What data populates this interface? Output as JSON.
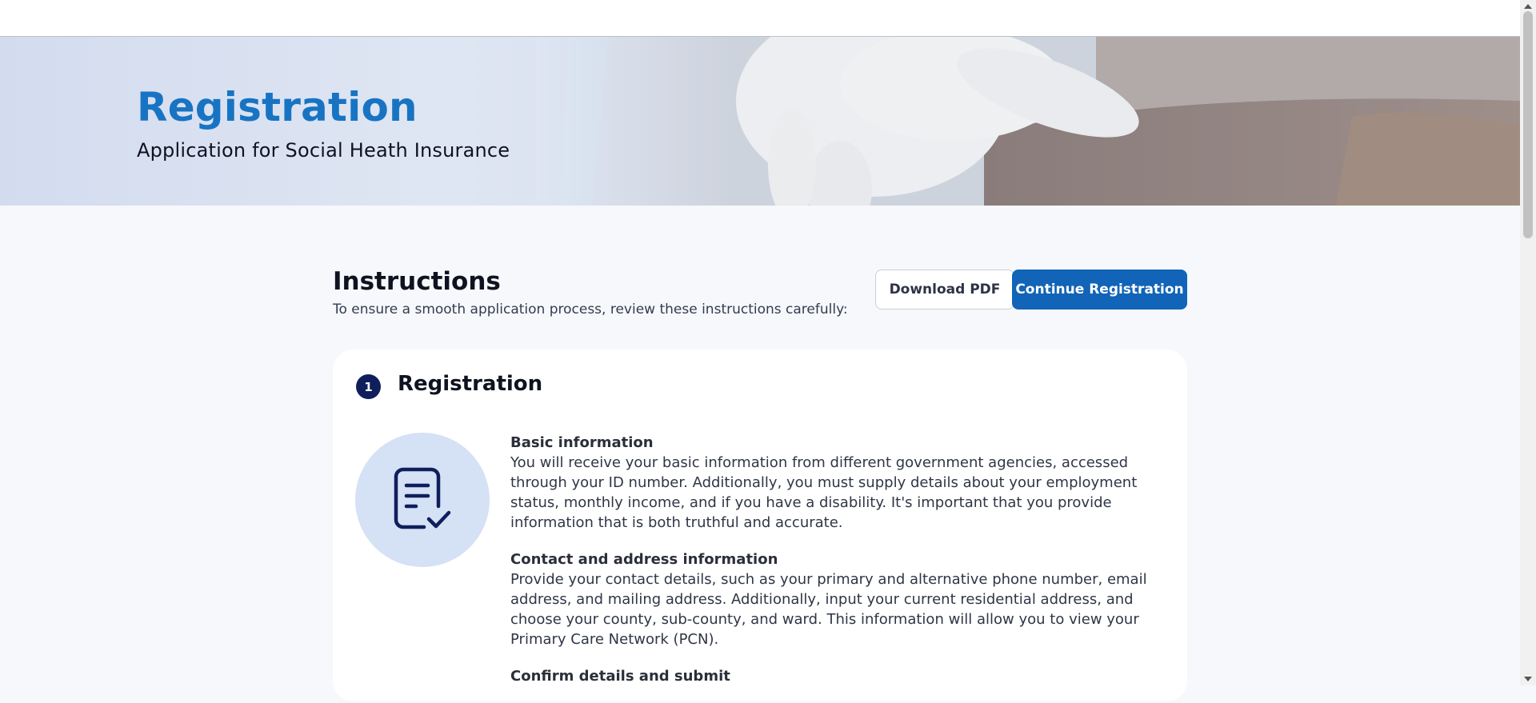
{
  "hero": {
    "title": "Registration",
    "subtitle": "Application for Social Heath Insurance"
  },
  "instructions": {
    "title": "Instructions",
    "subtitle": "To ensure a smooth application process, review these instructions carefully:",
    "download_label": "Download PDF",
    "continue_label": "Continue Registration"
  },
  "step": {
    "number": "1",
    "title": "Registration",
    "icon": "document-check-icon",
    "sections": [
      {
        "title": "Basic information",
        "body": "You will receive your basic information from different government agencies, accessed through your ID number. Additionally, you must supply details about your employment status, monthly income, and if you have a disability. It's important that you provide information that is both truthful and accurate."
      },
      {
        "title": "Contact and address information",
        "body": "Provide your contact details, such as your primary and alternative phone number, email address, and mailing address. Additionally, input your current residential address, and choose your county, sub-county, and ward. This information will allow you to view your Primary Care Network (PCN)."
      },
      {
        "title": "Confirm details and submit",
        "body": ""
      }
    ]
  },
  "colors": {
    "brand_blue": "#1874c3",
    "primary_button": "#1164b7",
    "step_badge": "#0f1f5c",
    "icon_circle": "#d5e1f4"
  }
}
